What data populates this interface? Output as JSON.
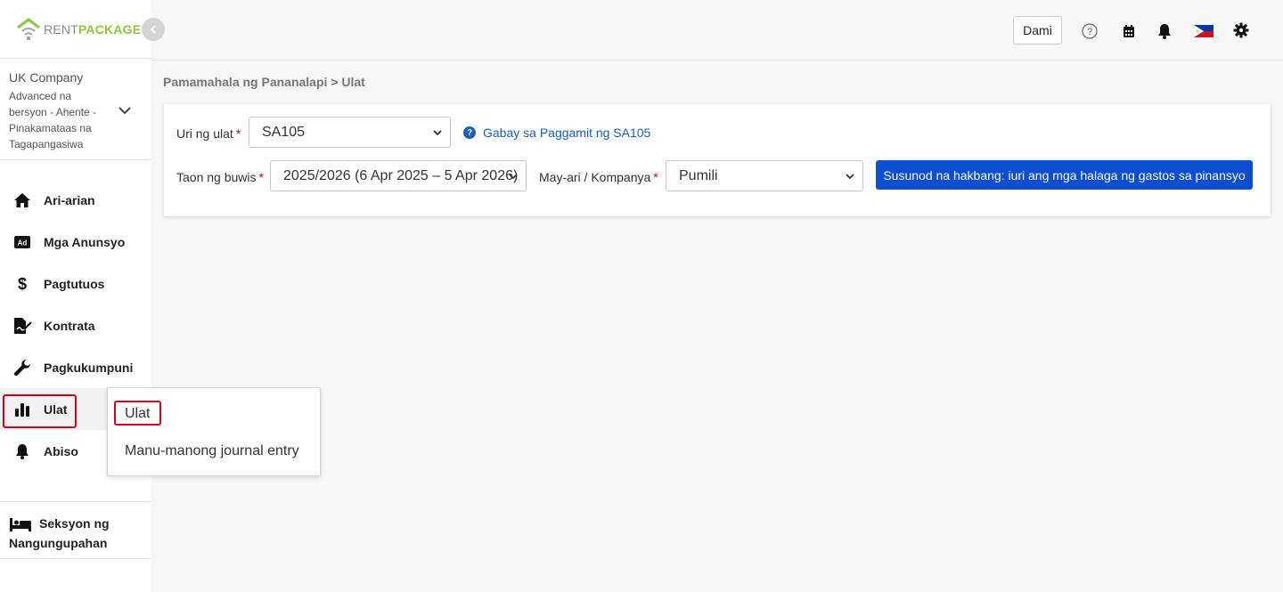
{
  "brand": {
    "name_part1": "RENT",
    "name_part2": "PACKAGE",
    "color_green": "#8dc63f",
    "color_grey": "#7f8c8d"
  },
  "company": {
    "name": "UK Company",
    "plan": "Advanced na bersyon - Ahente - Pinakamataas na Tagapangasiwa"
  },
  "sidebar": {
    "items": [
      {
        "label": "Ari-arian",
        "icon": "home-icon"
      },
      {
        "label": "Mga Anunsyo",
        "icon": "ad-icon"
      },
      {
        "label": "Pagtutuos",
        "icon": "dollar-icon"
      },
      {
        "label": "Kontrata",
        "icon": "contract-icon"
      },
      {
        "label": "Pagkukumpuni",
        "icon": "wrench-icon"
      },
      {
        "label": "Ulat",
        "icon": "bar-chart-icon",
        "active": true
      },
      {
        "label": "Abiso",
        "icon": "bell-icon"
      }
    ],
    "tenant_section": "Seksyon ng Nangungupahan"
  },
  "topbar": {
    "dami_label": "Dami",
    "icons": [
      "help-icon",
      "calendar-icon",
      "bell-icon",
      "philippines-flag-icon",
      "gear-icon"
    ]
  },
  "breadcrumb": {
    "parent": "Pamamahala ng Pananalapi",
    "separator": ">",
    "current": "Ulat"
  },
  "form": {
    "report_type_label": "Uri ng ulat",
    "report_type_value": "SA105",
    "help_link": "Gabay sa Paggamit ng SA105",
    "tax_year_label": "Taon ng buwis",
    "tax_year_value": "2025/2026 (6 Apr 2025 – 5 Apr 2026)",
    "owner_label": "May-ari / Kompanya",
    "owner_value": "Pumili",
    "required_mark": "*",
    "next_button": "Susunod na hakbang: iuri ang mga halaga ng gastos sa pinansyo"
  },
  "submenu": {
    "items": [
      "Ulat",
      "Manu-manong journal entry"
    ]
  },
  "colors": {
    "accent_blue": "#0b4fd0",
    "link_blue": "#1a5fb4",
    "highlight_red": "#d0021b"
  }
}
